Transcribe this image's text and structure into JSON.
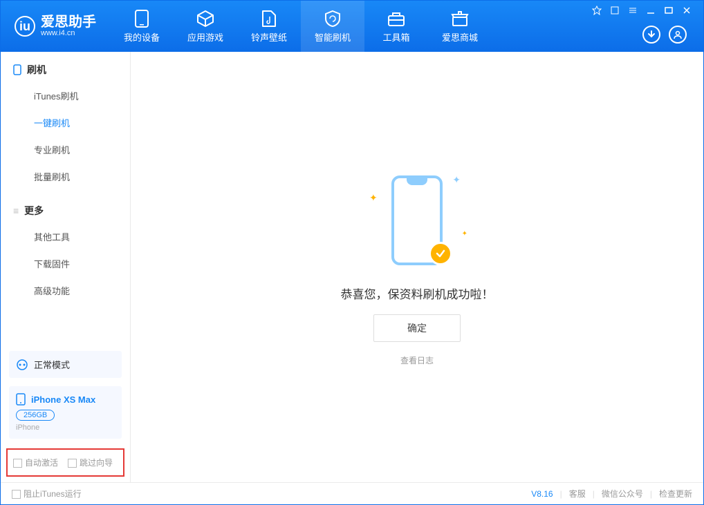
{
  "app": {
    "name": "爱思助手",
    "url": "www.i4.cn"
  },
  "nav": {
    "tabs": [
      {
        "label": "我的设备"
      },
      {
        "label": "应用游戏"
      },
      {
        "label": "铃声壁纸"
      },
      {
        "label": "智能刷机"
      },
      {
        "label": "工具箱"
      },
      {
        "label": "爱思商城"
      }
    ]
  },
  "sidebar": {
    "section1_title": "刷机",
    "section1_items": [
      {
        "label": "iTunes刷机"
      },
      {
        "label": "一键刷机"
      },
      {
        "label": "专业刷机"
      },
      {
        "label": "批量刷机"
      }
    ],
    "section2_title": "更多",
    "section2_items": [
      {
        "label": "其他工具"
      },
      {
        "label": "下载固件"
      },
      {
        "label": "高级功能"
      }
    ],
    "status_mode": "正常模式",
    "device": {
      "name": "iPhone XS Max",
      "capacity": "256GB",
      "type": "iPhone"
    },
    "opt_auto_activate": "自动激活",
    "opt_skip_guide": "跳过向导"
  },
  "main": {
    "success_message": "恭喜您，保资料刷机成功啦！",
    "ok_button": "确定",
    "view_log": "查看日志"
  },
  "footer": {
    "block_itunes": "阻止iTunes运行",
    "version": "V8.16",
    "customer_service": "客服",
    "wechat": "微信公众号",
    "check_update": "检查更新"
  },
  "colors": {
    "primary": "#1888f7",
    "accent": "#ffb300",
    "highlight_border": "#e53935"
  }
}
